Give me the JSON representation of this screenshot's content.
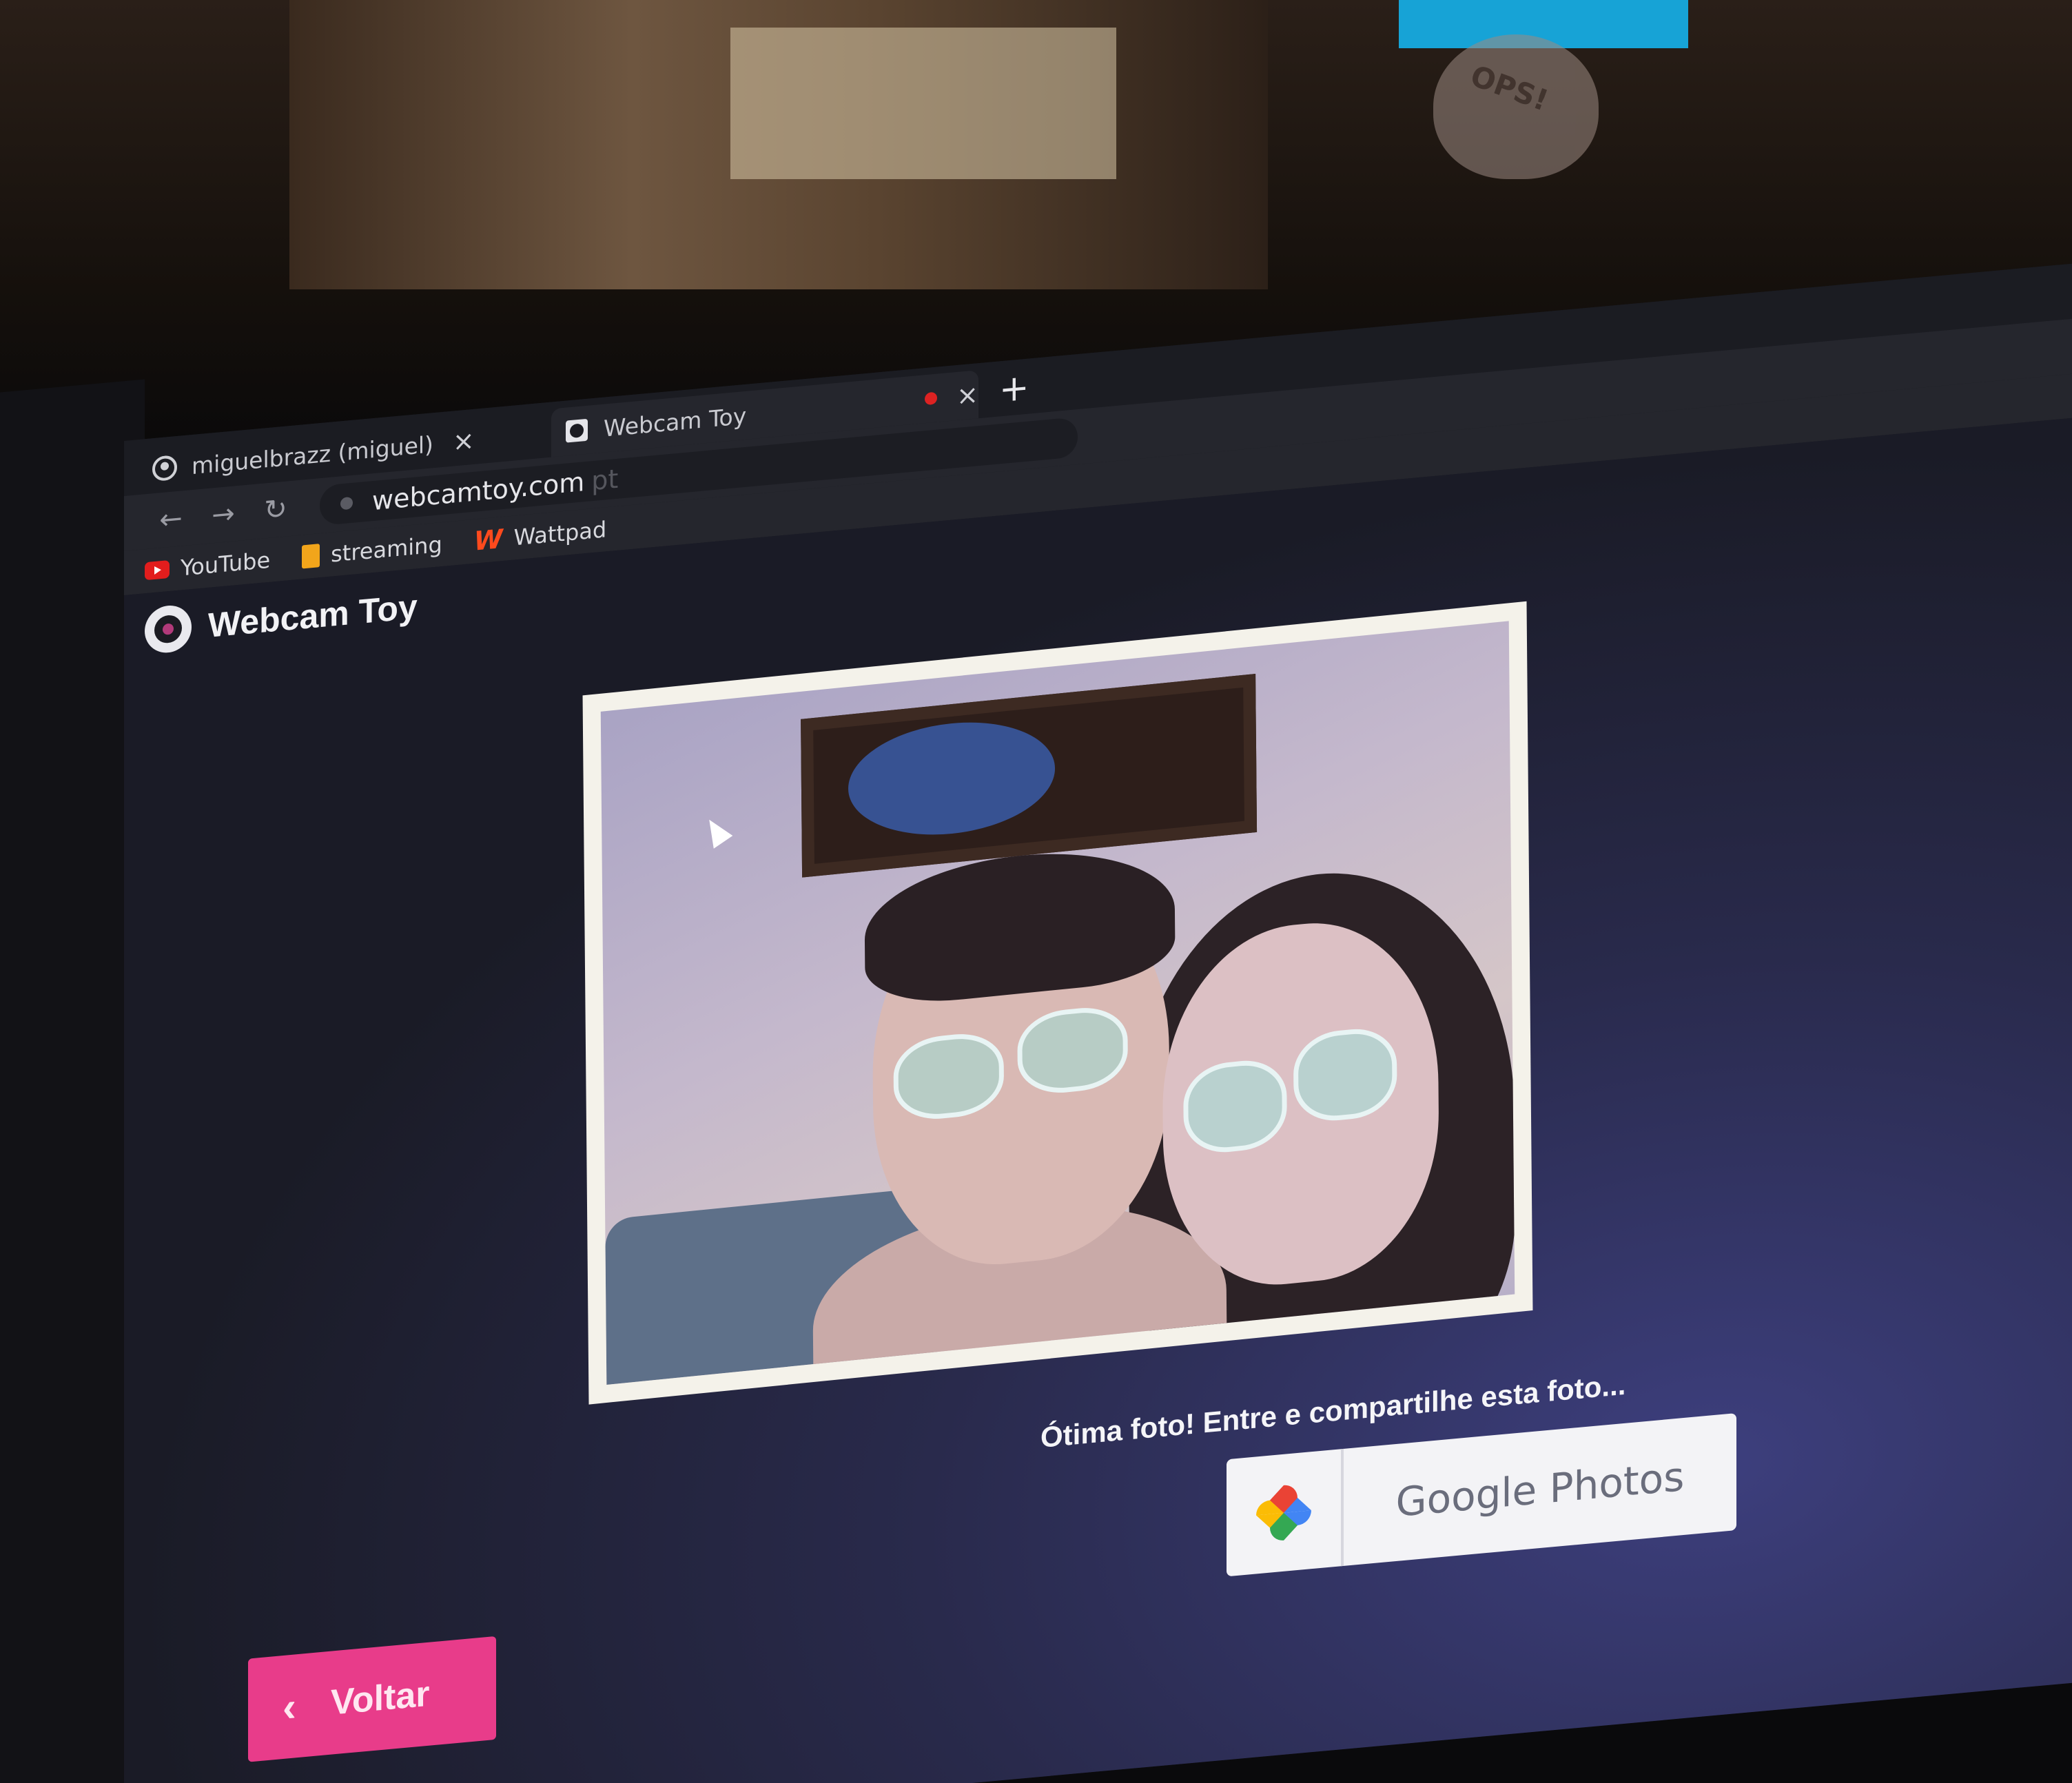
{
  "browser": {
    "tabs": [
      {
        "title": "miguelbrazz (miguel)",
        "icon": "github-icon",
        "close": "×"
      },
      {
        "title": "Webcam Toy",
        "icon": "webcam-toy-icon",
        "close": "×",
        "recording": true
      }
    ],
    "new_tab": "+",
    "address": {
      "url": "webcamtoy.com",
      "suffix": "pt"
    },
    "nav": {
      "back": "←",
      "forward": "→",
      "reload": "↻"
    },
    "bookmarks": [
      {
        "label": "YouTube",
        "icon": "youtube-icon"
      },
      {
        "label": "streaming",
        "icon": "folder-icon"
      },
      {
        "label": "Wattpad",
        "icon": "wattpad-icon",
        "glyph": "W"
      }
    ]
  },
  "page": {
    "site_title": "Webcam Toy",
    "share_prompt": "Ótima foto! Entre e compartilhe esta foto...",
    "share_button": "Google Photos",
    "back_button": "Voltar",
    "back_chevron": "‹"
  },
  "scene": {
    "sticker_text": "OPS!"
  },
  "colors": {
    "accent_pink": "#e83c8a",
    "page_dark": "#1a1b26",
    "page_glow": "#3d3f7e"
  }
}
